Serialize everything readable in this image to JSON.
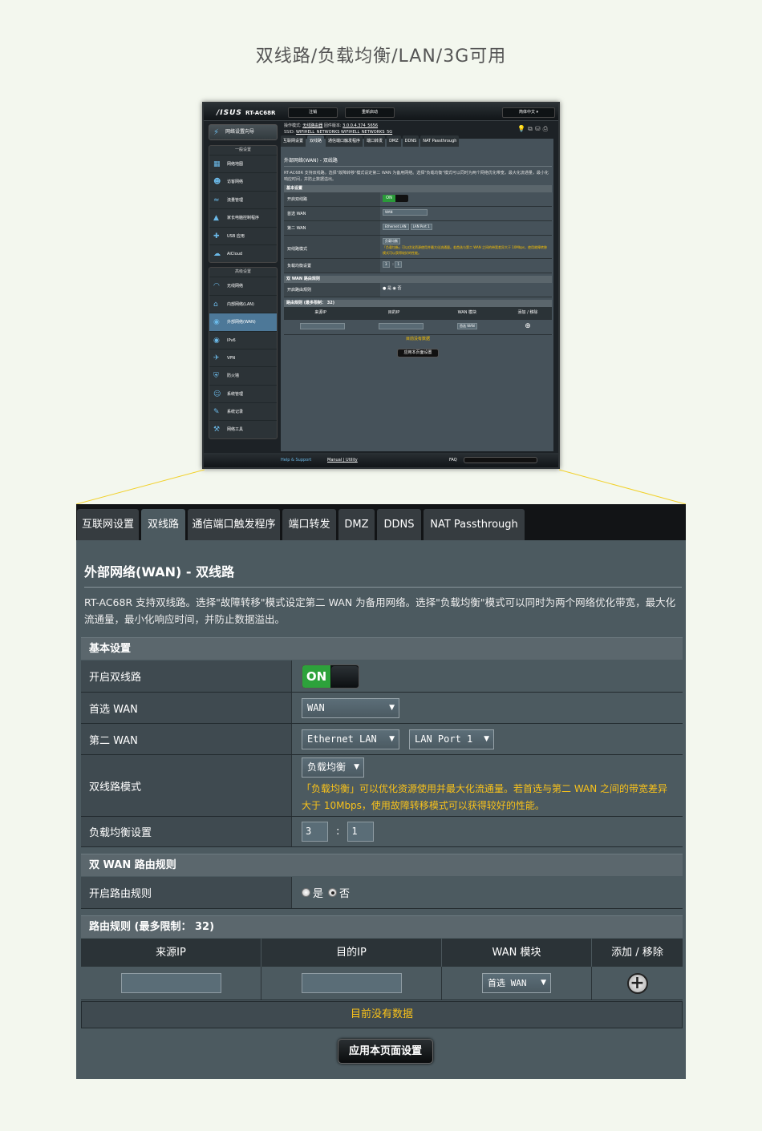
{
  "page_title": "双线路/负载均衡/LAN/3G可用",
  "thumbnail": {
    "logo": "/ISUS",
    "model": "RT-AC68R",
    "top_buttons": [
      "注销",
      "重新启动",
      "简体中文"
    ],
    "info_line1_prefix": "操作模式:",
    "info_line1_mode": "无线路由器",
    "info_line1_fw_prefix": "固件版本:",
    "info_line1_fw": "3.0.0.4.374_5656",
    "info_line2_prefix": "SSID:",
    "info_line2_ssid": "WIFIHELL_NETWORKS  WIFIHELL_NETWORKS_5G",
    "quick_setup": "网络设置向导",
    "general_title": "一般设置",
    "general_items": [
      "网络地图",
      "访客网络",
      "流量管理",
      "家长电脑控制程序",
      "USB 应用",
      "AiCloud"
    ],
    "advanced_title": "高级设置",
    "advanced_items": [
      "无线网络",
      "内部网络(LAN)",
      "外部网络(WAN)",
      "IPv6",
      "VPN",
      "防火墙",
      "系统管理",
      "系统记录",
      "网络工具"
    ],
    "tabs": [
      "互联网设置",
      "双线路",
      "通信端口触发程序",
      "端口转发",
      "DMZ",
      "DDNS",
      "NAT Passthrough"
    ],
    "heading": "外部网络(WAN) - 双线路",
    "desc": "RT-AC68R 支持双线路。选择\"故障转移\"模式设定第二 WAN 为备用网络。选择\"负载均衡\"模式可以同时为两个网络优化带宽，最大化流通量，最小化响应时间，并防止数据溢出。",
    "bottom_help": "Help & Support",
    "bottom_manual": "Manual | Utility",
    "bottom_faq": "FAQ"
  },
  "panel": {
    "tabs": [
      "互联网设置",
      "双线路",
      "通信端口触发程序",
      "端口转发",
      "DMZ",
      "DDNS",
      "NAT Passthrough"
    ],
    "active_tab": "双线路",
    "heading": "外部网络(WAN) - 双线路",
    "description": "RT-AC68R 支持双线路。选择\"故障转移\"模式设定第二 WAN 为备用网络。选择\"负载均衡\"模式可以同时为两个网络优化带宽，最大化流通量，最小化响应时间，并防止数据溢出。",
    "basic": {
      "title": "基本设置",
      "enable_label": "开启双线路",
      "enable_value": "ON",
      "primary_label": "首选 WAN",
      "primary_value": "WAN",
      "secondary_label": "第二 WAN",
      "secondary_value": "Ethernet LAN",
      "secondary_port": "LAN Port 1",
      "mode_label": "双线路模式",
      "mode_value": "负载均衡",
      "mode_note": "「负载均衡」可以优化资源使用并最大化流通量。若首选与第二 WAN 之间的带宽差异大于 10Mbps，使用故障转移模式可以获得较好的性能。",
      "lb_label": "负载均衡设置",
      "lb_a": "3",
      "lb_b": "1",
      "lb_sep": ":"
    },
    "routing": {
      "title": "双 WAN 路由规则",
      "enable_label": "开启路由规则",
      "yes": "是",
      "no": "否",
      "selected": "否"
    },
    "rules": {
      "title": "路由规则 (最多限制： 32)",
      "columns": [
        "来源IP",
        "目的IP",
        "WAN 模块",
        "添加 / 移除"
      ],
      "wan_select": "首选 WAN",
      "empty": "目前没有数据"
    },
    "apply": "应用本页面设置"
  }
}
